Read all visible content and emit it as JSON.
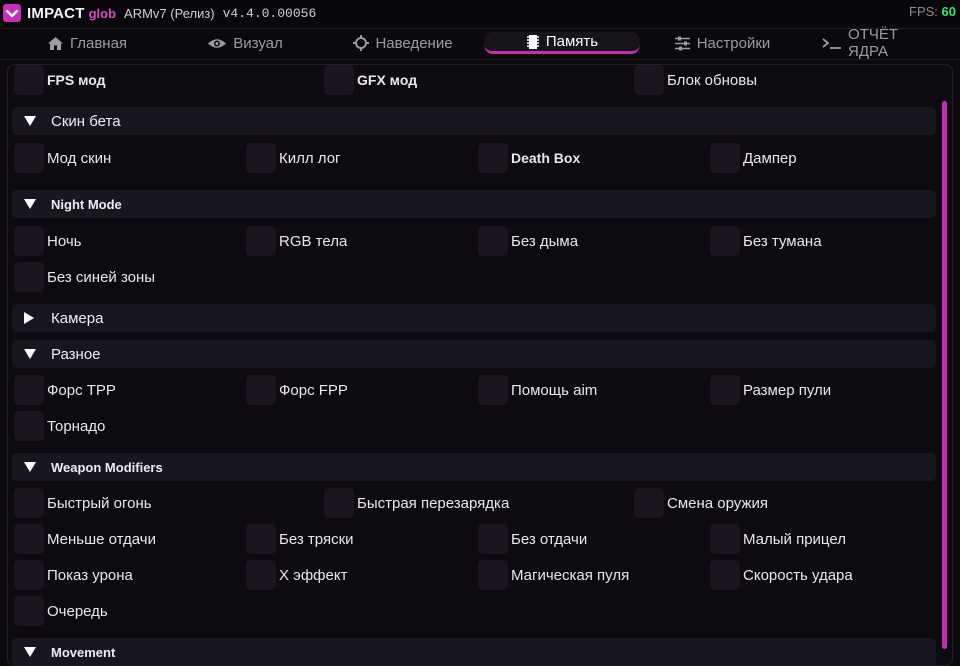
{
  "title": {
    "brand": "IMPACT",
    "brand_sub": "glob",
    "arch": "ARMv7 (Релиз)",
    "version": "v4.4.0.00056",
    "fps_label": "FPS:",
    "fps_value": "60"
  },
  "tabs": [
    {
      "label": "Главная",
      "icon": "home-icon"
    },
    {
      "label": "Визуал",
      "icon": "eye-icon"
    },
    {
      "label": "Наведение",
      "icon": "crosshair-icon"
    },
    {
      "label": "Память",
      "icon": "memory-icon",
      "active": true
    },
    {
      "label": "Настройки",
      "icon": "sliders-icon"
    },
    {
      "label": "ОТЧЁТ ЯДРА",
      "icon": "terminal-icon"
    }
  ],
  "top_row": [
    "FPS мод",
    "GFX мод",
    "Блок обновы"
  ],
  "sections": [
    {
      "label": "Скин бета",
      "expanded": true,
      "items": [
        "Мод скин",
        "Килл лог",
        "Death Box",
        "Дампер"
      ]
    },
    {
      "label": "Night Mode",
      "expanded": true,
      "items": [
        "Ночь",
        "RGB тела",
        "Без дыма",
        "Без тумана",
        "Без синей зоны"
      ]
    },
    {
      "label": "Камера",
      "expanded": false,
      "items": []
    },
    {
      "label": "Разное",
      "expanded": true,
      "items": [
        "Форс TPP",
        "Форс FPP",
        "Помощь aim",
        "Размер пули",
        "Торнадо"
      ]
    },
    {
      "label": "Weapon Modifiers",
      "expanded": true,
      "items": [
        "Быстрый огонь",
        "Быстрая перезарядка",
        "Смена оружия",
        "Меньше отдачи",
        "Без тряски",
        "Без отдачи",
        "Малый прицел",
        "Показ урона",
        "X эффект",
        "Магическая пуля",
        "Скорость удара",
        "Очередь"
      ]
    },
    {
      "label": "Movement",
      "expanded": true,
      "items": []
    }
  ],
  "colors": {
    "accent": "#c02fb0",
    "fps": "#3be07a",
    "checkbox": "#1b1520",
    "header": "#1a1620"
  }
}
